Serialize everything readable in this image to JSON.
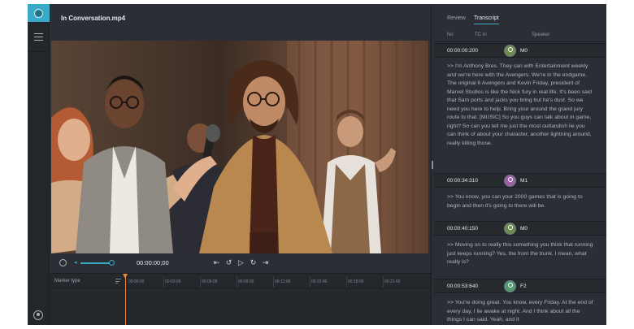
{
  "app": {
    "file_title": "In Conversation.mp4"
  },
  "player": {
    "timecode": "00:00:00;00",
    "controls": [
      "skip-to-start",
      "rewind",
      "play",
      "forward",
      "skip-to-end"
    ]
  },
  "timeline": {
    "marker_label": "Marker type",
    "ticks": [
      "00:00:00",
      "00:03:00",
      "00:06:00",
      "00:09:00",
      "00:12:00",
      "00:15:00",
      "00:18:00",
      "00:21:00"
    ]
  },
  "panel": {
    "tabs": [
      {
        "label": "Review",
        "active": false
      },
      {
        "label": "Transcript",
        "active": true
      }
    ],
    "columns": {
      "no": "No",
      "tc_in": "TC In",
      "speaker": "Speaker"
    },
    "entries": [
      {
        "tc": "00:00:00:200",
        "speaker": "M0",
        "avatar_color": "#6e8a4f",
        "text": ">> I'm Anthony Bres. They can with Entertainment weekly and we're here with the Avengers. We're in the endgame. The original 6 Avengers and Kevin Friday, president of Marvel Studios is like the Nick fury in real life. It's been said that Sam ports and jacks you bring but he's dust. So we need you here to help. Bring your around the grand jury route to that. [MUSIC] So you guys can talk about in game, right? So can you tell me just the most outlandish lie you can think of about your character, another lightning around, really killing those."
      },
      {
        "tc": "00:00:34:310",
        "speaker": "M1",
        "avatar_color": "#9a5fa6",
        "text": ">> You know, you can your 2000 games that is going to begin and then it's going to there will be."
      },
      {
        "tc": "00:00:40:150",
        "speaker": "M0",
        "avatar_color": "#6e8a4f",
        "text": ">> Moving on to really this something you think that running just keeps running? Yes, the from the trunk. I mean, what really is?"
      },
      {
        "tc": "00:00:53:640",
        "speaker": "F2",
        "avatar_color": "#4f9a6e",
        "text": ">> You're doing great. You know, every Friday. At the end of every day, I lie awake at night. And I think about all the things I can said. Yeah, and it"
      }
    ]
  },
  "colors": {
    "accent": "#39a9c8",
    "playhead": "#e58a3a",
    "background": "#2b2f35"
  }
}
